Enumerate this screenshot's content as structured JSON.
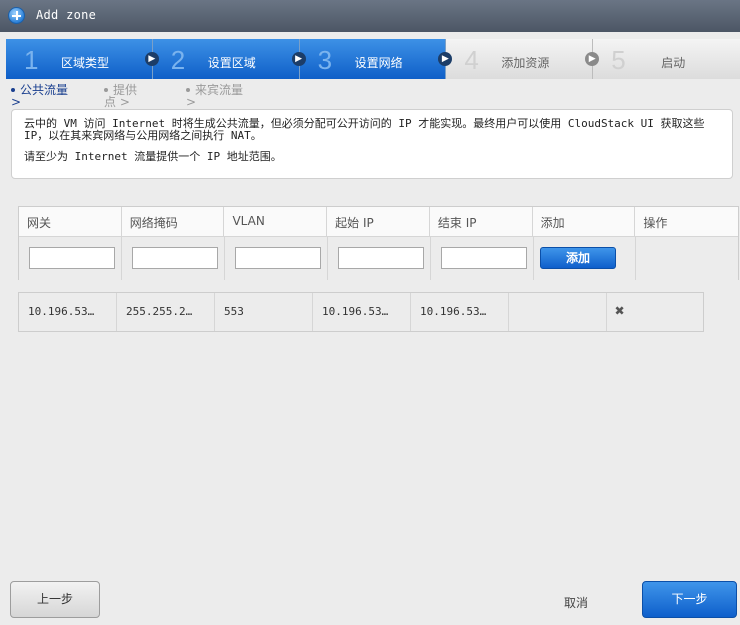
{
  "window": {
    "title": "Add zone"
  },
  "steps": [
    {
      "number": "1",
      "label": "区域类型",
      "state": "active"
    },
    {
      "number": "2",
      "label": "设置区域",
      "state": "active"
    },
    {
      "number": "3",
      "label": "设置网络",
      "state": "active"
    },
    {
      "number": "4",
      "label": "添加资源",
      "state": "inactive"
    },
    {
      "number": "5",
      "label": "启动",
      "state": "inactive"
    }
  ],
  "subtabs": [
    {
      "label": "公共流量",
      "state": "active"
    },
    {
      "label": "提供点",
      "state": "inactive"
    },
    {
      "label": "来宾流量",
      "state": "inactive"
    }
  ],
  "info": {
    "line1": "云中的 VM 访问 Internet 时将生成公共流量，但必须分配可公开访问的 IP 才能实现。最终用户可以使用 CloudStack UI 获取这些 IP，以在其来宾网络与公用网络之间执行 NAT。",
    "line2": "请至少为 Internet 流量提供一个 IP 地址范围。"
  },
  "table": {
    "headers": [
      "网关",
      "网络掩码",
      "VLAN",
      "起始 IP",
      "结束 IP",
      "添加",
      "操作"
    ],
    "add_button": "添加",
    "row": [
      "10.196.53…",
      "255.255.2…",
      "553",
      "10.196.53…",
      "10.196.53…",
      ""
    ]
  },
  "footer": {
    "prev": "上一步",
    "cancel": "取消",
    "next": "下一步"
  },
  "colors": {
    "accent": "#0f5fc8",
    "accent_light": "#3d91e6",
    "title_bar": "#5a6473"
  },
  "icons": {
    "title": "add-circle-icon",
    "step_arrow": "chevron-right-icon",
    "remove": "close-icon"
  }
}
